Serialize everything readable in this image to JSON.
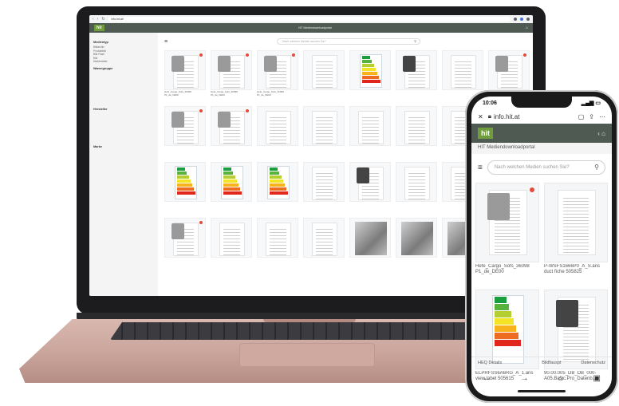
{
  "laptop": {
    "url": "info.hit.at/",
    "app_logo": "hit",
    "app_title": "HIT Mediendownloadportal",
    "search_placeholder": "Nach welchen Medien suchen Sie?",
    "sidebar": {
      "groups": [
        {
          "heading": "Medientyp",
          "items": [
            "Bildarchiv",
            "Produktbild",
            "Bild Flash",
            "Bild",
            "Mediendatei"
          ]
        },
        {
          "heading": "Warengruppe",
          "items": [
            "",
            "",
            "",
            "",
            "",
            "",
            "",
            "",
            ""
          ]
        },
        {
          "heading": "Hersteller",
          "items": [
            "",
            "",
            "",
            "",
            "",
            "",
            "",
            ""
          ]
        },
        {
          "heading": "Marke",
          "items": [
            "",
            "",
            "",
            "",
            "",
            "",
            "",
            "",
            ""
          ]
        }
      ]
    },
    "cards": [
      {
        "kind": "product",
        "caption": "Hefe_Cargo_Sofs_36098 P1_de_DE00"
      },
      {
        "kind": "product",
        "caption": "Hefe_Cargo_Sofs_36098 P1_de_DE00"
      },
      {
        "kind": "product",
        "caption": "Hefe_Cargo_Sofs_36098 P1_de_DE00"
      },
      {
        "kind": "doc",
        "caption": ""
      },
      {
        "kind": "energy",
        "caption": ""
      },
      {
        "kind": "product-dark",
        "caption": ""
      },
      {
        "kind": "doc",
        "caption": ""
      },
      {
        "kind": "product",
        "caption": ""
      },
      {
        "kind": "product",
        "caption": ""
      },
      {
        "kind": "product",
        "caption": ""
      },
      {
        "kind": "doc",
        "caption": ""
      },
      {
        "kind": "doc",
        "caption": ""
      },
      {
        "kind": "doc",
        "caption": ""
      },
      {
        "kind": "doc",
        "caption": ""
      },
      {
        "kind": "doc",
        "caption": ""
      },
      {
        "kind": "doc",
        "caption": ""
      },
      {
        "kind": "energy",
        "caption": ""
      },
      {
        "kind": "energy",
        "caption": ""
      },
      {
        "kind": "energy",
        "caption": ""
      },
      {
        "kind": "doc",
        "caption": ""
      },
      {
        "kind": "product-dark",
        "caption": ""
      },
      {
        "kind": "doc",
        "caption": ""
      },
      {
        "kind": "doc",
        "caption": ""
      },
      {
        "kind": "doc",
        "caption": ""
      },
      {
        "kind": "product",
        "caption": ""
      },
      {
        "kind": "doc",
        "caption": ""
      },
      {
        "kind": "doc",
        "caption": ""
      },
      {
        "kind": "doc",
        "caption": ""
      },
      {
        "kind": "photo",
        "caption": ""
      },
      {
        "kind": "photo",
        "caption": ""
      },
      {
        "kind": "photo",
        "caption": ""
      },
      {
        "kind": "doc",
        "caption": ""
      }
    ]
  },
  "phone": {
    "time": "10:06",
    "url": "info.hit.at",
    "logo": "hit",
    "subtitle": "HIT Mediendownloadportal",
    "search_placeholder": "Nach welchen Medien suchen Sie?",
    "cards": [
      {
        "kind": "product",
        "caption": "Hefe_Cargo_Sofs_36098 P1_de_DE00"
      },
      {
        "kind": "doc",
        "caption": "P-WSFS1666P0_A_S.ans duct fiche 505825"
      },
      {
        "kind": "energy",
        "caption": "ELPRFSS6A6RG_A_1.ans view label 505615"
      },
      {
        "kind": "product-dark",
        "caption": "90.00.005_DB_DB_000-A05.Basic.Pro_Datenb..."
      }
    ],
    "tabs": [
      "HEQ Details",
      "",
      "Bildfauspt",
      "Datenschutz"
    ]
  }
}
